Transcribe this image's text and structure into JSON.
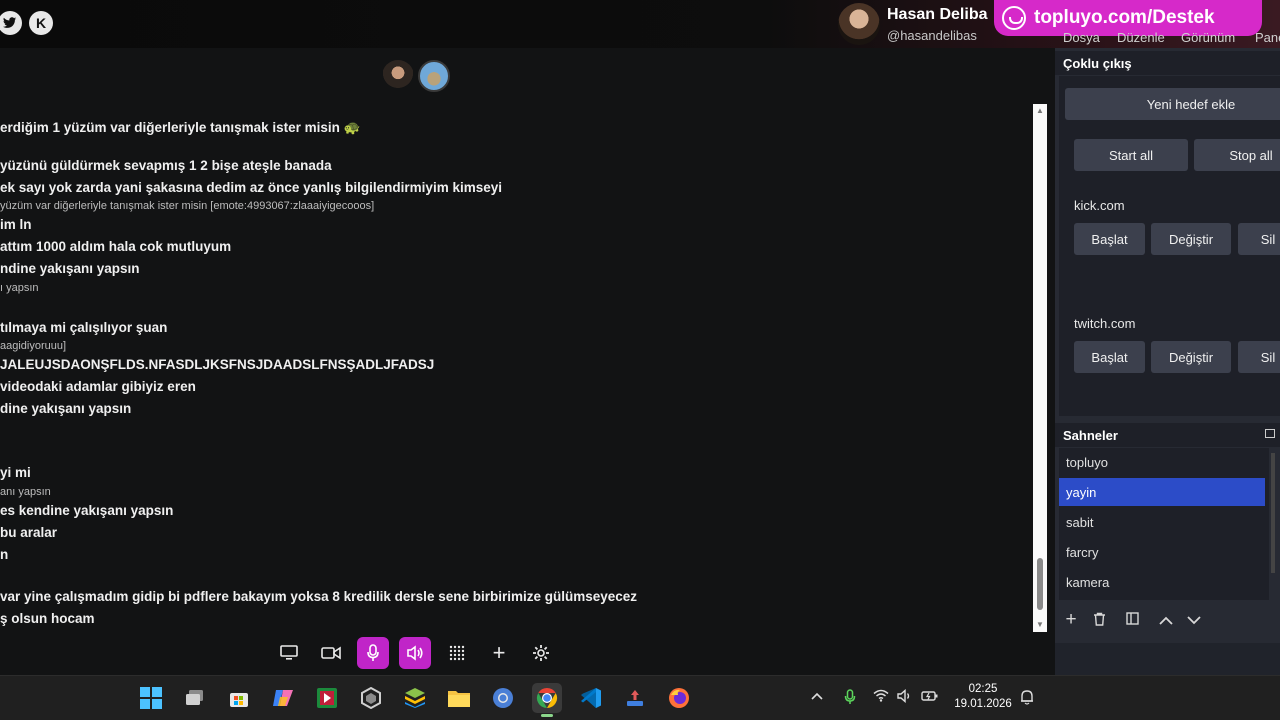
{
  "topbar": {
    "streamer_name": "Hasan Deliba",
    "streamer_handle": "@hasandelibas",
    "support_text": "topluyo.com/Destek",
    "twitter_icon": "twitter-icon",
    "kick_icon": "kick-icon"
  },
  "chat": {
    "messages": [
      "erdiğim 1 yüzüm var diğerleriyle tanışmak ister misin 🐢",
      "yüzünü güldürmek sevapmış 1 2 bişe ateşle banada",
      "ek sayı yok zarda yani şakasına dedim az önce yanlış bilgilendirmiyim kimseyi",
      "yüzüm var diğerleriyle tanışmak ister misin [emote:4993067:zlaaaiyigecooos]",
      "im ln",
      "attım 1000 aldım hala cok mutluyum",
      "ndine yakışanı yapsın",
      "ı yapsın",
      "tılmaya mi çalışılıyor şuan",
      "aagidiyoruuu]",
      "JALEUJSDAONŞFLDS.NFASDLJKSFNSJDAADSLFNSŞADLJFADSJ",
      "videodaki adamlar gibiyiz eren",
      "dine yakışanı yapsın",
      "yi mi",
      "anı yapsın",
      "es kendine yakışanı yapsın",
      "bu aralar",
      "n",
      "var yine çalışmadım gidip bi pdflere bakayım yoksa 8 kredilik dersle sene birbirimize gülümseyecez",
      "ş olsun hocam"
    ]
  },
  "controls": {
    "screen": "monitor-icon",
    "camera": "camera-icon",
    "mic": "microphone-icon",
    "speaker": "speaker-icon",
    "grid": "grid-icon",
    "add": "+",
    "settings": "gear-icon"
  },
  "obs": {
    "menu": [
      "Dosya",
      "Düzenle",
      "Görünüm",
      "Pane"
    ],
    "multi_output_title": "Çoklu çıkış",
    "add_target": "Yeni hedef ekle",
    "start_all": "Start all",
    "stop_all": "Stop all",
    "targets": [
      {
        "name": "kick.com",
        "start": "Başlat",
        "edit": "Değiştir",
        "delete": "Sil"
      },
      {
        "name": "twitch.com",
        "start": "Başlat",
        "edit": "Değiştir",
        "delete": "Sil"
      }
    ],
    "scenes_title": "Sahneler",
    "scenes": [
      "topluyo",
      "yayin",
      "sabit",
      "farcry",
      "kamera"
    ],
    "selected_scene": "yayin"
  },
  "taskbar": {
    "time": "02:25",
    "date": "19.01.2026"
  }
}
